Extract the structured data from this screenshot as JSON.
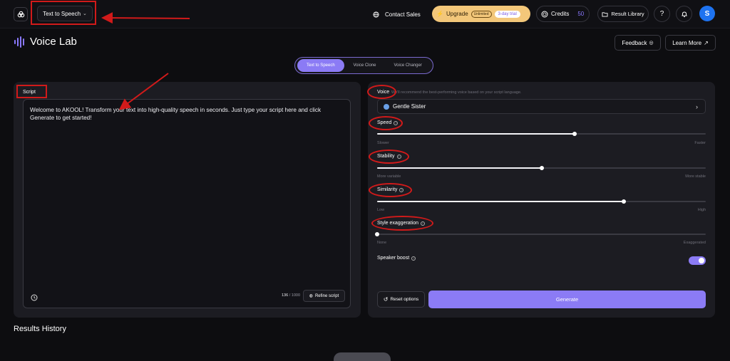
{
  "topbar": {
    "mode_select": "Text to Speech",
    "contact_sales": "Contact Sales",
    "upgrade": "Upgrade",
    "unlimited": "Unlimited",
    "trial": "3-day trial",
    "credits_label": "Credits",
    "credits_value": "50",
    "result_library": "Result Library",
    "help": "?",
    "avatar_initial": "S"
  },
  "page": {
    "title": "Voice Lab",
    "feedback": "Feedback",
    "learn_more": "Learn More"
  },
  "tabs": [
    {
      "label": "Text to Speech",
      "active": true
    },
    {
      "label": "Voice Clone",
      "active": false
    },
    {
      "label": "Voice Changer",
      "active": false
    }
  ],
  "script": {
    "label": "Script",
    "text": "Welcome to AKOOL! Transform your text into high-quality speech in seconds. Just type your script here and click Generate to get started!",
    "count": "136",
    "max": "/ 1000",
    "refine": "Refine script"
  },
  "voice": {
    "label": "Voice",
    "hint": "We'll recommend the best-performing voice based on your script language.",
    "selected": "Gentle Sister"
  },
  "settings": {
    "speed": {
      "label": "Speed",
      "min": "Slower",
      "max": "Faster",
      "value": 0.6
    },
    "stability": {
      "label": "Stability",
      "min": "More variable",
      "max": "More stable",
      "value": 0.5
    },
    "similarity": {
      "label": "Similarity",
      "min": "Low",
      "max": "High",
      "value": 0.75
    },
    "style": {
      "label": "Style exaggeration",
      "min": "None",
      "max": "Exaggerated",
      "value": 0.0
    },
    "speaker_boost": {
      "label": "Speaker boost",
      "on": true
    }
  },
  "actions": {
    "reset": "Reset options",
    "generate": "Generate"
  },
  "history": {
    "title": "Results History"
  },
  "colors": {
    "accent": "#8b7bf5",
    "annotation": "#d11a1a",
    "upgrade_bg": "#f3c77a",
    "avatar_bg": "#1e73f0"
  }
}
